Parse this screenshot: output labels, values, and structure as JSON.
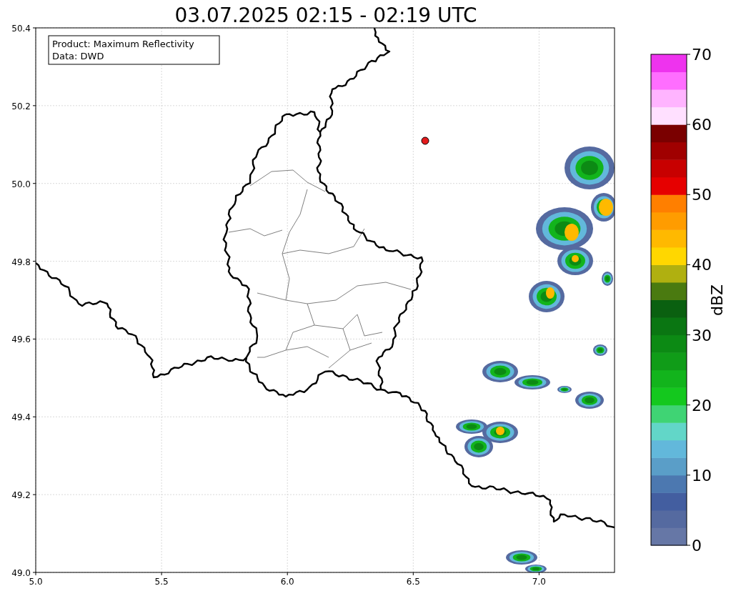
{
  "title": "03.07.2025 02:15 - 02:19 UTC",
  "info_box": [
    "Product: Maximum Reflectivity",
    "Data: DWD"
  ],
  "map": {
    "x_ticks": [
      "5.0",
      "5.5",
      "6.0",
      "6.5",
      "7.0"
    ],
    "y_ticks": [
      "50.4",
      "50.2",
      "50.0",
      "49.8",
      "49.6",
      "49.4",
      "49.2",
      "49.0"
    ]
  },
  "colorbar": {
    "label": "dBZ",
    "ticks": [
      "70",
      "60",
      "50",
      "40",
      "30",
      "20",
      "10",
      "0"
    ],
    "segments": [
      {
        "color": "#6677a6"
      },
      {
        "color": "#556aa0"
      },
      {
        "color": "#435ea0"
      },
      {
        "color": "#4c78b0"
      },
      {
        "color": "#5a9ec8"
      },
      {
        "color": "#62b8db"
      },
      {
        "color": "#62d6c8"
      },
      {
        "color": "#3fd474"
      },
      {
        "color": "#14c81e"
      },
      {
        "color": "#12b41c"
      },
      {
        "color": "#109c18"
      },
      {
        "color": "#0c8a14"
      },
      {
        "color": "#0a7612"
      },
      {
        "color": "#0a6010"
      },
      {
        "color": "#4a7a10"
      },
      {
        "color": "#b0b010"
      },
      {
        "color": "#ffd700"
      },
      {
        "color": "#ffb900"
      },
      {
        "color": "#ff9c00"
      },
      {
        "color": "#ff7f00"
      },
      {
        "color": "#e60000"
      },
      {
        "color": "#c80000"
      },
      {
        "color": "#a00000"
      },
      {
        "color": "#7a0000"
      },
      {
        "color": "#ffe0ff"
      },
      {
        "color": "#ffb4ff"
      },
      {
        "color": "#ff6eff"
      },
      {
        "color": "#ee33ee"
      }
    ]
  }
}
